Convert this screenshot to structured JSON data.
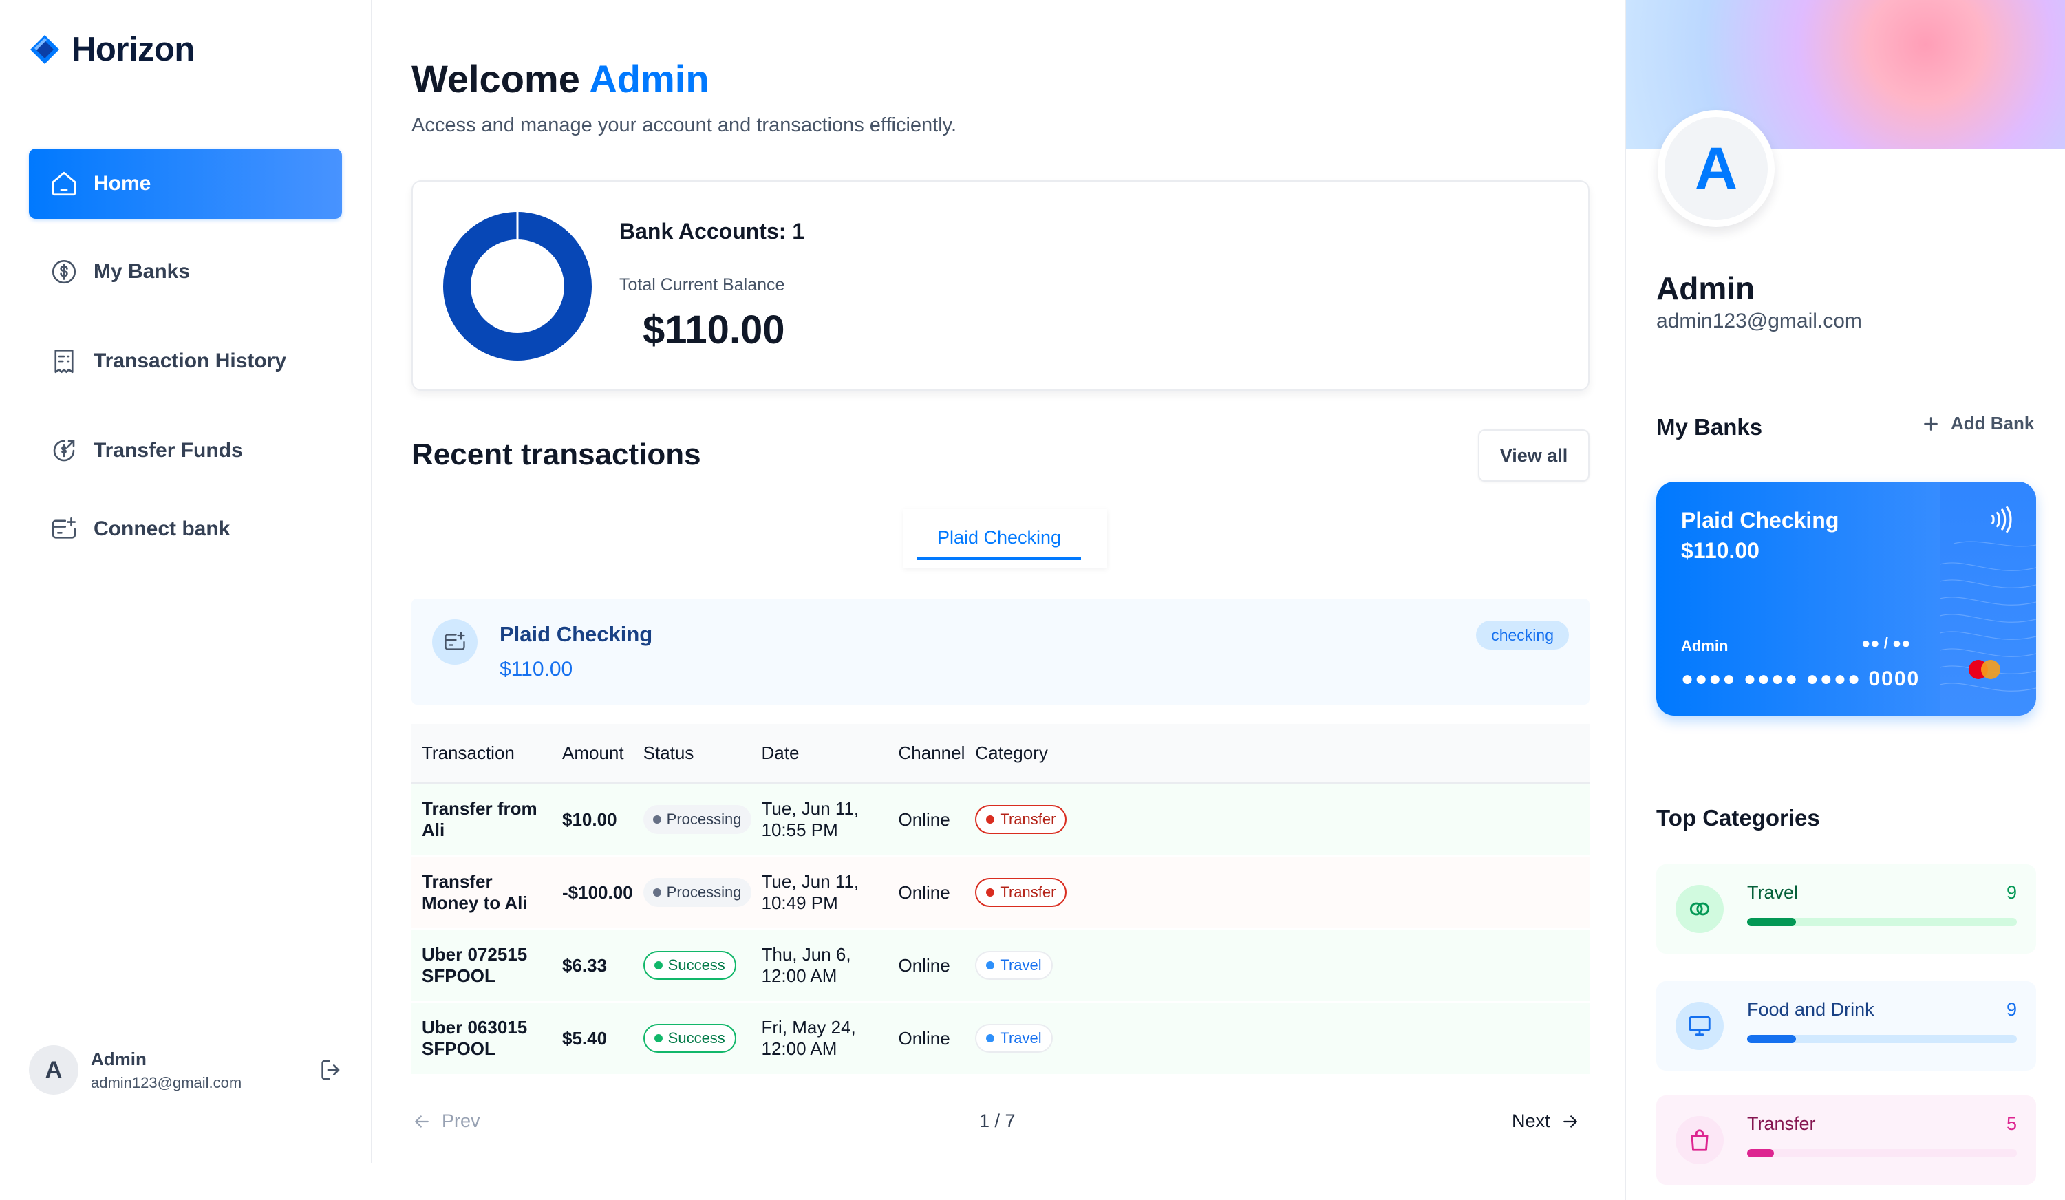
{
  "app": {
    "name": "Horizon"
  },
  "sidebar": {
    "items": [
      {
        "label": "Home",
        "icon": "home-icon",
        "active": true
      },
      {
        "label": "My Banks",
        "icon": "dollar-circle-icon"
      },
      {
        "label": "Transaction History",
        "icon": "receipt-icon"
      },
      {
        "label": "Transfer Funds",
        "icon": "money-send-icon"
      },
      {
        "label": "Connect bank",
        "icon": "card-add-icon"
      }
    ],
    "user": {
      "initial": "A",
      "name": "Admin",
      "email": "admin123@gmail.com"
    }
  },
  "header": {
    "welcome": "Welcome",
    "user": "Admin",
    "subtitle": "Access and manage your account and transactions efficiently."
  },
  "balance": {
    "accounts_label": "Bank Accounts: 1",
    "total_label": "Total Current Balance",
    "total": "$110.00",
    "donut_color": "#0747b6"
  },
  "recent": {
    "title": "Recent transactions",
    "view_all": "View all",
    "tab": "Plaid Checking",
    "account": {
      "name": "Plaid Checking",
      "balance": "$110.00",
      "type": "checking"
    },
    "columns": [
      "Transaction",
      "Amount",
      "Status",
      "Date",
      "Channel",
      "Category"
    ],
    "rows": [
      {
        "name": "Transfer from Ali",
        "amount": "$10.00",
        "status": "Processing",
        "date": "Tue, Jun 11, 10:55 PM",
        "channel": "Online",
        "category": "Transfer"
      },
      {
        "name": "Transfer Money to Ali",
        "amount": "-$100.00",
        "status": "Processing",
        "date": "Tue, Jun 11, 10:49 PM",
        "channel": "Online",
        "category": "Transfer"
      },
      {
        "name": "Uber 072515 SFPOOL",
        "amount": "$6.33",
        "status": "Success",
        "date": "Thu, Jun 6, 12:00 AM",
        "channel": "Online",
        "category": "Travel"
      },
      {
        "name": "Uber 063015 SFPOOL",
        "amount": "$5.40",
        "status": "Success",
        "date": "Fri, May 24, 12:00 AM",
        "channel": "Online",
        "category": "Travel"
      }
    ],
    "pager": {
      "prev": "Prev",
      "page": "1 / 7",
      "next": "Next"
    }
  },
  "profile": {
    "initial": "A",
    "name": "Admin",
    "email": "admin123@gmail.com"
  },
  "mybanks": {
    "title": "My Banks",
    "add": "Add Bank",
    "card": {
      "name": "Plaid Checking",
      "balance": "$110.00",
      "holder": "Admin",
      "expiry": "●● / ●●",
      "number": "●●●● ●●●● ●●●● 0000"
    }
  },
  "top_categories": {
    "title": "Top Categories",
    "items": [
      {
        "name": "Travel",
        "count": "9",
        "progress": 0.18,
        "bg": "#f6fef9",
        "track": "#d1fadf",
        "fill": "#039855",
        "icon_bg": "#d1fadf",
        "text": "#05603a",
        "count_color": "#039855"
      },
      {
        "name": "Food and Drink",
        "count": "9",
        "progress": 0.18,
        "bg": "#f5faff",
        "track": "#d1e9ff",
        "fill": "#1570ef",
        "icon_bg": "#d1e9ff",
        "text": "#194185",
        "count_color": "#1570ef"
      },
      {
        "name": "Transfer",
        "count": "5",
        "progress": 0.1,
        "bg": "#fdf2fa",
        "track": "#fce7f6",
        "fill": "#dd2590",
        "icon_bg": "#fce7f6",
        "text": "#851651",
        "count_color": "#dd2590"
      }
    ]
  }
}
